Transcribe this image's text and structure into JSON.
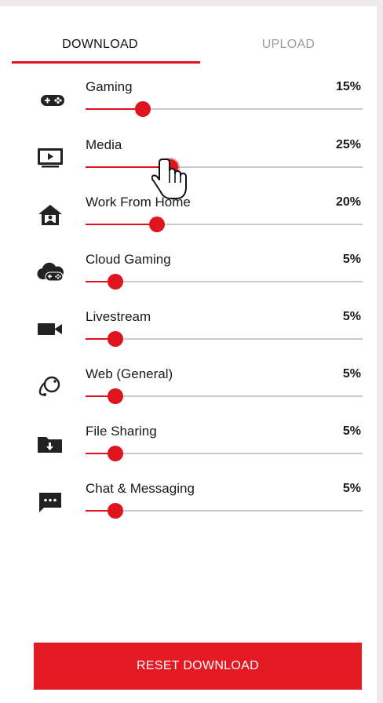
{
  "tabs": {
    "download": "DOWNLOAD",
    "upload": "UPLOAD"
  },
  "categories": [
    {
      "label": "Gaming",
      "percent": "15%",
      "value": 15,
      "icon": "gamepad-icon"
    },
    {
      "label": "Media",
      "percent": "25%",
      "value": 25,
      "icon": "tv-play-icon"
    },
    {
      "label": "Work From Home",
      "percent": "20%",
      "value": 20,
      "icon": "home-person-icon"
    },
    {
      "label": "Cloud Gaming",
      "percent": "5%",
      "value": 5,
      "icon": "cloud-gaming-icon"
    },
    {
      "label": "Livestream",
      "percent": "5%",
      "value": 5,
      "icon": "video-camera-icon"
    },
    {
      "label": "Web (General)",
      "percent": "5%",
      "value": 5,
      "icon": "globe-icon"
    },
    {
      "label": "File Sharing",
      "percent": "5%",
      "value": 5,
      "icon": "folder-download-icon"
    },
    {
      "label": "Chat & Messaging",
      "percent": "5%",
      "value": 5,
      "icon": "chat-icon"
    }
  ],
  "reset_label": "RESET DOWNLOAD",
  "colors": {
    "accent": "#e0141e",
    "track": "#c9c9c9",
    "background": "#ebe9ea"
  }
}
